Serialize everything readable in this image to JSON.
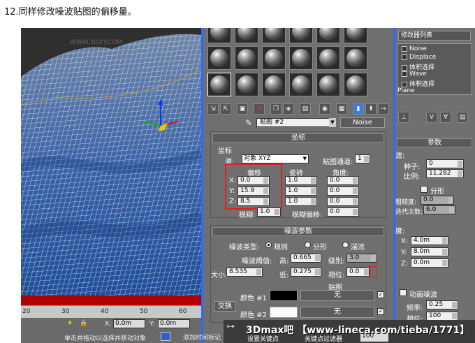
{
  "caption": "12.同样修改噪波贴图的偏移量。",
  "viewport": {
    "watermark": "WWW.3DXY.COM"
  },
  "ruler": {
    "ticks": [
      "20",
      "30",
      "40",
      "50",
      "60"
    ]
  },
  "status": {
    "x_label": "X:",
    "x_value": "0.0m",
    "y_label": "Y:",
    "y_value": "0.0m",
    "prompt": "单击并拖动以选择并移动对象",
    "add_time_tag": "添加时间标记",
    "set_key": "设置关键点",
    "key_filter": "关键点过滤器",
    "frame": "100"
  },
  "mated": {
    "map_name": "贴图 #2",
    "map_type": "Noise",
    "coords": {
      "header": "坐标",
      "group": "坐标",
      "source_label": "源:",
      "source_value": "对象 XYZ",
      "map_channel_label": "贴图通道:",
      "map_channel_value": "1",
      "offset_label": "偏移",
      "tiling_label": "瓷砖",
      "angle_label": "角度:",
      "x": "X:",
      "y": "Y:",
      "z": "Z:",
      "offset": [
        "0.0",
        "15.9",
        "8.5"
      ],
      "tiling": [
        "1.0",
        "1.0",
        "1.0"
      ],
      "angle": [
        "0.0",
        "0.0",
        "0.0"
      ],
      "blur_label": "模糊:",
      "blur_value": "1.0",
      "blur_offset_label": "模糊偏移:",
      "blur_offset_value": "0.0"
    },
    "noise": {
      "header": "噪波参数",
      "type_label": "噪波类型:",
      "types": [
        "规则",
        "分形",
        "湍流"
      ],
      "threshold_label": "噪波阈值:",
      "high_label": "高:",
      "high_value": "0.665",
      "levels_label": "级别:",
      "levels_value": "3.0",
      "size_label": "大小:",
      "size_value": "8.535",
      "low_label": "低:",
      "low_value": "0.275",
      "phase_label": "相位:",
      "phase_value": "0.0",
      "maps_label": "贴图",
      "swap_label": "交换",
      "color1_label": "颜色 #1",
      "color2_label": "颜色 #2",
      "none": "无"
    }
  },
  "cmdpanel": {
    "modifier_list": "修改器列表",
    "stack": [
      "Noise",
      "Displace",
      "体积选择",
      "Wave",
      "体积选择",
      "Plane"
    ],
    "params_header": "参数",
    "noise_group": "波:",
    "seed_label": "种子:",
    "seed_value": "0",
    "scale_label": "比例:",
    "scale_value": "11.282",
    "fractal_label": "分形",
    "roughness_label": "粗糙度:",
    "roughness_value": "0.0",
    "iterations_label": "迭代次数:",
    "iterations_value": "6.0",
    "strength_group": "度:",
    "x_label": "X:",
    "x_value": "4.0m",
    "y_label": "Y:",
    "y_value": "8.0m",
    "z_label": "Z:",
    "z_value": "0.0m",
    "anim_label": "动画噪波",
    "freq_label": "频率:",
    "freq_value": "0.25",
    "phase_label": "相位:",
    "phase_value": "100"
  },
  "footer_watermark": "3Dmax吧 【www-lineca.com/tieba/1771】"
}
